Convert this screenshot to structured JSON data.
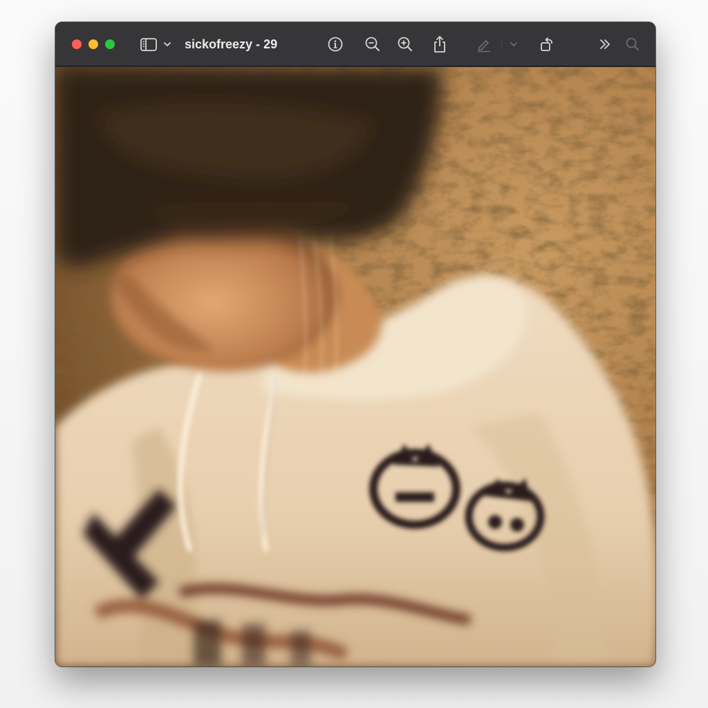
{
  "window": {
    "title": "sickofreezy - 29"
  },
  "toolbar": {
    "sidebar_toggle_icon": "sidebar-icon",
    "sidebar_menu_icon": "chevron-down-icon",
    "info_icon": "info-icon",
    "zoom_out_icon": "zoom-out-icon",
    "zoom_in_icon": "zoom-in-icon",
    "share_icon": "share-icon",
    "markup_icon": "pencil-icon",
    "markup_menu_icon": "chevron-down-icon",
    "rotate_icon": "rotate-icon",
    "more_icon": "double-chevron-right-icon",
    "search_icon": "search-icon"
  },
  "colors": {
    "close": "#ff5f57",
    "minimize": "#febc2e",
    "zoom": "#28c840",
    "titlebar": "#363638",
    "toolbar_icon": "#d6d6d6",
    "toolbar_icon_disabled": "#6d6d6f"
  }
}
